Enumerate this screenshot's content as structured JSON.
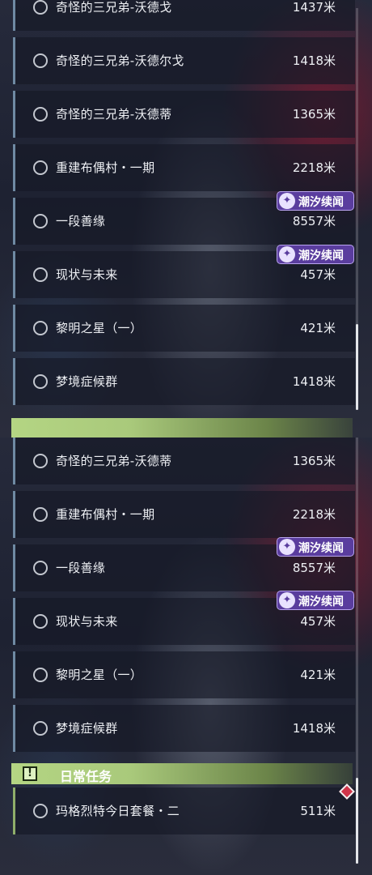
{
  "badge_label": "潮汐续闻",
  "top_panel": {
    "rows": [
      {
        "name": "奇怪的三兄弟-沃德戈",
        "distance": "1437米"
      },
      {
        "name": "奇怪的三兄弟-沃德尔戈",
        "distance": "1418米"
      },
      {
        "name": "奇怪的三兄弟-沃德蒂",
        "distance": "1365米"
      },
      {
        "name": "重建布偶村・一期",
        "distance": "2218米"
      },
      {
        "name": "一段善缘",
        "distance": "8557米"
      },
      {
        "name": "现状与未来",
        "distance": "457米"
      },
      {
        "name": "黎明之星（一）",
        "distance": "421米"
      },
      {
        "name": "梦境症候群",
        "distance": "1418米"
      }
    ]
  },
  "bottom_panel": {
    "rows": [
      {
        "name": "奇怪的三兄弟-沃德蒂",
        "distance": "1365米"
      },
      {
        "name": "重建布偶村・一期",
        "distance": "2218米"
      },
      {
        "name": "一段善缘",
        "distance": "8557米"
      },
      {
        "name": "现状与未来",
        "distance": "457米"
      },
      {
        "name": "黎明之星（一）",
        "distance": "421米"
      },
      {
        "name": "梦境症候群",
        "distance": "1418米"
      }
    ],
    "daily_section": {
      "title": "日常任务",
      "rows": [
        {
          "name": "玛格烈特今日套餐・二",
          "distance": "511米"
        }
      ]
    }
  },
  "colors": {
    "badge_bg": "#5a3d9e",
    "section_green": "#b4d583",
    "row_accent": "#6f8aa3",
    "marker_red": "#d0354a"
  }
}
